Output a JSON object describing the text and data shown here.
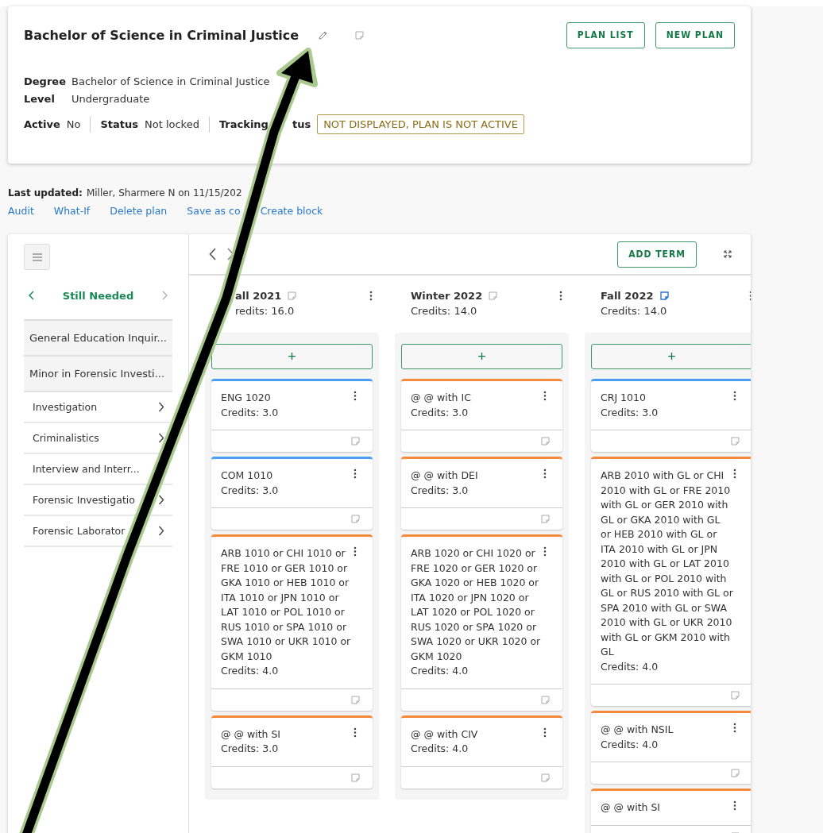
{
  "plan": {
    "title": "Bachelor of Science in Criminal Justice",
    "buttons": [
      "PLAN LIST",
      "NEW PLAN"
    ],
    "details": [
      {
        "label": "Degree",
        "value": "Bachelor of Science in Criminal Justice"
      },
      {
        "label": "Level",
        "value": "Undergraduate"
      }
    ],
    "statuses": [
      {
        "label": "Active",
        "value": "No"
      },
      {
        "label": "Status",
        "value": "Not locked"
      },
      {
        "label": "Tracking",
        "label_tail": "tus",
        "value": "NOT DISPLAYED, PLAN IS NOT ACTIVE",
        "kind": "badge"
      }
    ]
  },
  "last_updated": {
    "label": "Last updated:",
    "value": "Miller, Sharmere N on 11/15/202"
  },
  "actions": [
    "Audit",
    "What-If",
    "Delete plan",
    "Save as co",
    "Create block"
  ],
  "sidebar": {
    "title": "Still Needed",
    "items": [
      {
        "label": "General Education Inquir...",
        "kind": "group"
      },
      {
        "label": "Minor in Forensic Investi...",
        "kind": "group"
      },
      {
        "label": "Investigation",
        "kind": "link"
      },
      {
        "label": "Criminalistics",
        "kind": "link"
      },
      {
        "label": "Interview and Interr...",
        "kind": "plain"
      },
      {
        "label": "Forensic Investigatio",
        "kind": "link"
      },
      {
        "label": "Forensic Laborator",
        "kind": "link"
      }
    ]
  },
  "board": {
    "add_term": "ADD TERM",
    "terms": [
      {
        "name": "all 2021",
        "credits": "redits:  16.0",
        "has_note": false,
        "add": "+",
        "courses": [
          {
            "title": "ENG 1020",
            "credits": "Credits: 3.0",
            "color": "#4a9ff5"
          },
          {
            "title": "COM 1010",
            "credits": "Credits: 3.0",
            "color": "#4a9ff5"
          },
          {
            "title": "ARB 1010 or CHI 1010 or FRE 1010 or GER 1010 or GKA 1010 or HEB 1010 or ITA 1010 or JPN 1010 or LAT 1010 or POL 1010 or RUS 1010 or SPA 1010 or SWA 1010 or UKR 1010 or GKM 1010",
            "credits": "Credits: 4.0",
            "color": "#f58a3c"
          },
          {
            "title": "@ @ with SI",
            "credits": "Credits: 3.0",
            "color": "#f58a3c"
          }
        ]
      },
      {
        "name": "Winter 2022",
        "credits": "Credits:  14.0",
        "has_note": false,
        "add": "+",
        "courses": [
          {
            "title": "@ @ with IC",
            "credits": "Credits: 3.0",
            "color": "#f58a3c"
          },
          {
            "title": "@ @ with DEI",
            "credits": "Credits: 3.0",
            "color": "#f58a3c"
          },
          {
            "title": "ARB 1020 or CHI 1020 or FRE 1020 or GER 1020 or GKA 1020 or HEB 1020 or ITA 1020 or JPN 1020 or LAT 1020 or POL 1020 or RUS 1020 or SPA 1020 or SWA 1020 or UKR 1020 or GKM 1020",
            "credits": "Credits: 4.0",
            "color": "#f58a3c"
          },
          {
            "title": "@ @ with CIV",
            "credits": "Credits: 4.0",
            "color": "#f58a3c"
          }
        ]
      },
      {
        "name": "Fall 2022",
        "credits": "Credits:  14.0",
        "has_note": true,
        "add": "+",
        "courses": [
          {
            "title": "CRJ 1010",
            "credits": "Credits: 3.0",
            "color": "#4a9ff5"
          },
          {
            "title": "ARB 2010 with GL or CHI 2010 with GL or FRE 2010 with GL or GER 2010 with GL or GKA 2010 with GL or HEB 2010 with GL or ITA 2010 with GL or JPN 2010 with GL or LAT 2010 with GL or POL 2010 with GL or RUS 2010 with GL or SPA 2010 with GL or SWA 2010 with GL or UKR 2010 with GL or GKM 2010 with GL",
            "credits": "Credits: 4.0",
            "color": "#f58a3c"
          },
          {
            "title": "@ @ with NSIL",
            "credits": "Credits: 4.0",
            "color": "#f58a3c"
          },
          {
            "title": "@ @ with SI",
            "color": "#f58a3c"
          }
        ]
      }
    ]
  }
}
